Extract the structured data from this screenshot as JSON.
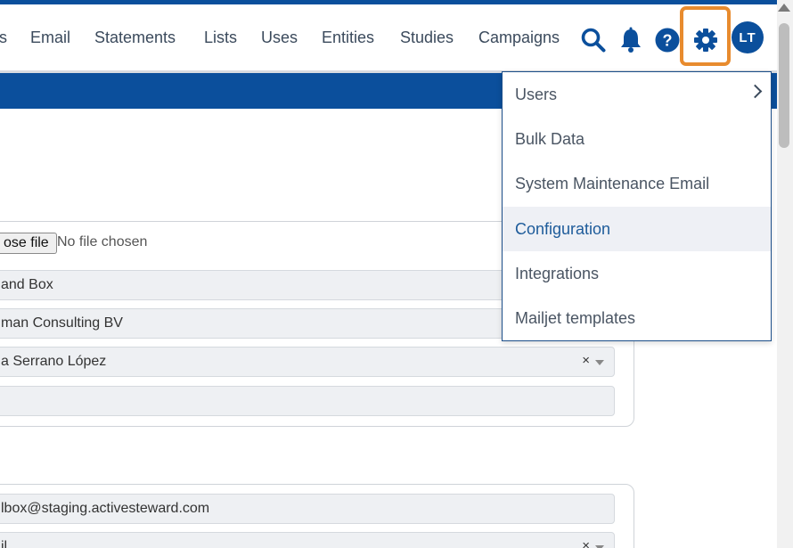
{
  "nav": {
    "items": [
      "s",
      "Email",
      "Statements",
      "Lists",
      "Uses",
      "Entities",
      "Studies",
      "Campaigns"
    ],
    "icons": [
      "search-icon",
      "bell-icon",
      "help-icon",
      "gear-icon"
    ],
    "avatar_initials": "LT"
  },
  "form": {
    "file_button_label": "ose file",
    "file_status": "No file chosen",
    "fields": [
      {
        "value": "and Box"
      },
      {
        "value": "man Consulting BV"
      },
      {
        "value": "a Serrano López",
        "clear": "×"
      },
      {
        "value": ""
      }
    ],
    "fields2": [
      {
        "value": "lbox@staging.activesteward.com"
      },
      {
        "value": "il",
        "clear": "×"
      }
    ]
  },
  "settings_menu": {
    "items": [
      {
        "label": "Users",
        "has_submenu": true
      },
      {
        "label": "Bulk Data"
      },
      {
        "label": "System Maintenance Email"
      },
      {
        "label": "Configuration",
        "active": true
      },
      {
        "label": "Integrations"
      },
      {
        "label": "Mailjet templates"
      }
    ]
  },
  "colors": {
    "brand_blue": "#0b4f9c",
    "focus_orange": "#e88b2e",
    "menu_active_bg": "#eef0f5"
  }
}
